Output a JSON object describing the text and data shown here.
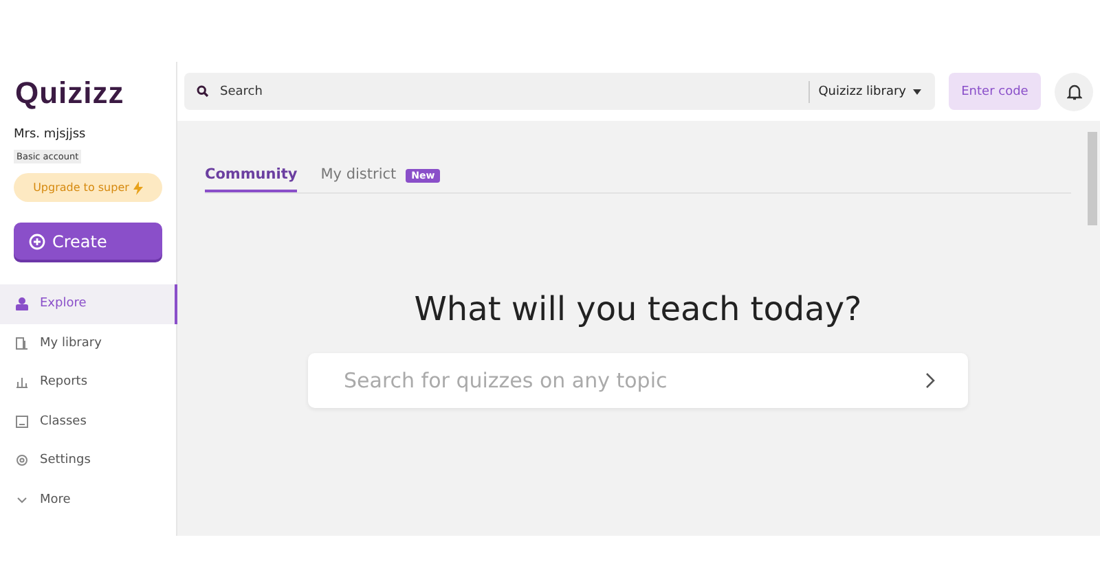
{
  "logo": "Quizizz",
  "user": {
    "name": "Mrs. mjsjjss",
    "plan": "Basic account"
  },
  "upgrade": "Upgrade to super",
  "create": "Create",
  "nav": [
    {
      "label": "Explore",
      "kind": "explore",
      "selected": true
    },
    {
      "label": "My library",
      "kind": "library",
      "selected": false
    },
    {
      "label": "Reports",
      "kind": "reports",
      "selected": false
    },
    {
      "label": "Classes",
      "kind": "classes",
      "selected": false
    },
    {
      "label": "Settings",
      "kind": "settings",
      "selected": false
    },
    {
      "label": "More",
      "kind": "more",
      "selected": false
    }
  ],
  "topbar": {
    "search_placeholder": "Search",
    "library": "Quizizz library",
    "enter_code": "Enter code"
  },
  "tabs": [
    {
      "label": "Community",
      "selected": true
    },
    {
      "label": "My district",
      "selected": false,
      "badge": "New"
    }
  ],
  "hero": {
    "title": "What will you teach today?",
    "search_placeholder": "Search for quizzes on any topic"
  }
}
